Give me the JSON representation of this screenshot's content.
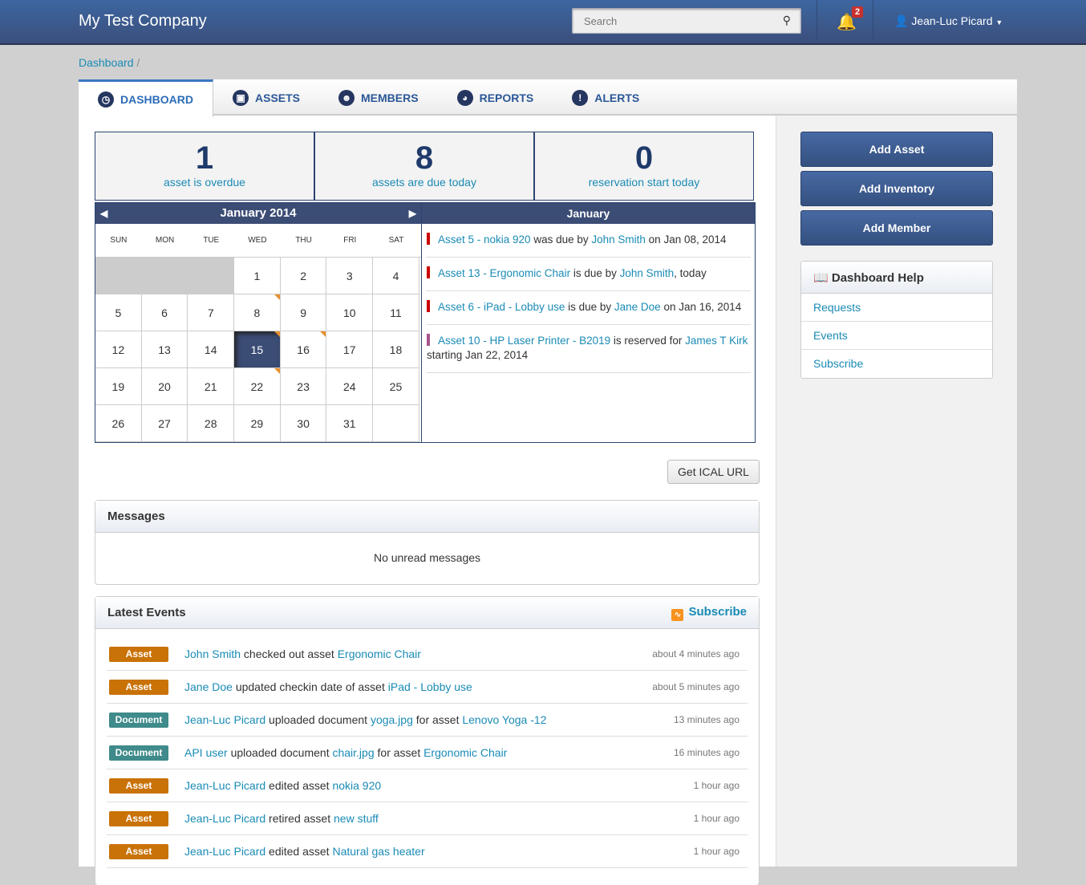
{
  "header": {
    "brand": "My Test Company",
    "search_placeholder": "Search",
    "notification_count": "2",
    "user": "Jean-Luc Picard"
  },
  "breadcrumb": {
    "items": [
      "Dashboard"
    ],
    "separator": "/"
  },
  "tabs": [
    {
      "label": "DASHBOARD",
      "icon": "dashboard-gauge-icon"
    },
    {
      "label": "ASSETS",
      "icon": "briefcase-icon"
    },
    {
      "label": "MEMBERS",
      "icon": "users-icon"
    },
    {
      "label": "REPORTS",
      "icon": "pie-chart-icon"
    },
    {
      "label": "ALERTS",
      "icon": "exclamation-icon"
    }
  ],
  "stats": [
    {
      "value": "1",
      "label": "asset is overdue"
    },
    {
      "value": "8",
      "label": "assets are due today"
    },
    {
      "value": "0",
      "label": "reservation start today"
    }
  ],
  "calendar": {
    "title": "January 2014",
    "weekdays": [
      "SUN",
      "MON",
      "TUE",
      "WED",
      "THU",
      "FRI",
      "SAT"
    ],
    "leading_blanks": 3,
    "days": 31,
    "selected": 15,
    "marked": [
      8,
      15,
      16,
      22
    ]
  },
  "month_events": {
    "title": "January",
    "color_overdue": "#cc0000",
    "color_reserved": "#a8548a",
    "items": [
      {
        "type": "due",
        "parts": [
          {
            "t": "Asset 5 - nokia 920",
            "link": true
          },
          {
            "t": " was due by "
          },
          {
            "t": "John Smith",
            "link": true
          },
          {
            "t": " on Jan 08, 2014"
          }
        ]
      },
      {
        "type": "due",
        "parts": [
          {
            "t": "Asset 13 - Ergonomic Chair",
            "link": true
          },
          {
            "t": " is due by "
          },
          {
            "t": "John Smith",
            "link": true
          },
          {
            "t": ", today"
          }
        ]
      },
      {
        "type": "due",
        "parts": [
          {
            "t": "Asset 6 - iPad - Lobby use",
            "link": true
          },
          {
            "t": " is due by "
          },
          {
            "t": "Jane Doe",
            "link": true
          },
          {
            "t": " on Jan 16, 2014"
          }
        ]
      },
      {
        "type": "reserved",
        "parts": [
          {
            "t": "Asset 10 - HP Laser Printer - B2019",
            "link": true
          },
          {
            "t": " is reserved for "
          },
          {
            "t": "James T Kirk",
            "link": true
          },
          {
            "t": " starting Jan 22, 2014"
          }
        ]
      }
    ]
  },
  "ical_button": "Get ICAL URL",
  "messages": {
    "title": "Messages",
    "empty": "No unread messages"
  },
  "latest_events": {
    "title": "Latest Events",
    "subscribe": "Subscribe",
    "items": [
      {
        "tag": "Asset",
        "time": "about 4 minutes ago",
        "parts": [
          {
            "t": "John Smith",
            "link": true
          },
          {
            "t": " checked out asset "
          },
          {
            "t": "Ergonomic Chair",
            "link": true
          }
        ]
      },
      {
        "tag": "Asset",
        "time": "about 5 minutes ago",
        "parts": [
          {
            "t": "Jane Doe",
            "link": true
          },
          {
            "t": " updated checkin date of asset "
          },
          {
            "t": "iPad - Lobby use",
            "link": true
          }
        ]
      },
      {
        "tag": "Document",
        "time": "13 minutes ago",
        "parts": [
          {
            "t": "Jean-Luc Picard",
            "link": true
          },
          {
            "t": " uploaded document "
          },
          {
            "t": "yoga.jpg",
            "link": true
          },
          {
            "t": " for asset "
          },
          {
            "t": "Lenovo Yoga -12",
            "link": true
          }
        ]
      },
      {
        "tag": "Document",
        "time": "16 minutes ago",
        "parts": [
          {
            "t": "API user",
            "link": true
          },
          {
            "t": " uploaded document "
          },
          {
            "t": "chair.jpg",
            "link": true
          },
          {
            "t": " for asset "
          },
          {
            "t": "Ergonomic Chair",
            "link": true
          }
        ]
      },
      {
        "tag": "Asset",
        "time": "1 hour ago",
        "parts": [
          {
            "t": "Jean-Luc Picard",
            "link": true
          },
          {
            "t": " edited asset "
          },
          {
            "t": "nokia 920",
            "link": true
          }
        ]
      },
      {
        "tag": "Asset",
        "time": "1 hour ago",
        "parts": [
          {
            "t": "Jean-Luc Picard",
            "link": true
          },
          {
            "t": " retired asset "
          },
          {
            "t": "new stuff",
            "link": true
          }
        ]
      },
      {
        "tag": "Asset",
        "time": "1 hour ago",
        "parts": [
          {
            "t": "Jean-Luc Picard",
            "link": true
          },
          {
            "t": " edited asset "
          },
          {
            "t": "Natural gas heater",
            "link": true
          }
        ]
      }
    ]
  },
  "sidebar": {
    "buttons": [
      "Add Asset",
      "Add Inventory",
      "Add Member"
    ],
    "help_title": "Dashboard Help",
    "help_links": [
      "Requests",
      "Events",
      "Subscribe"
    ]
  }
}
